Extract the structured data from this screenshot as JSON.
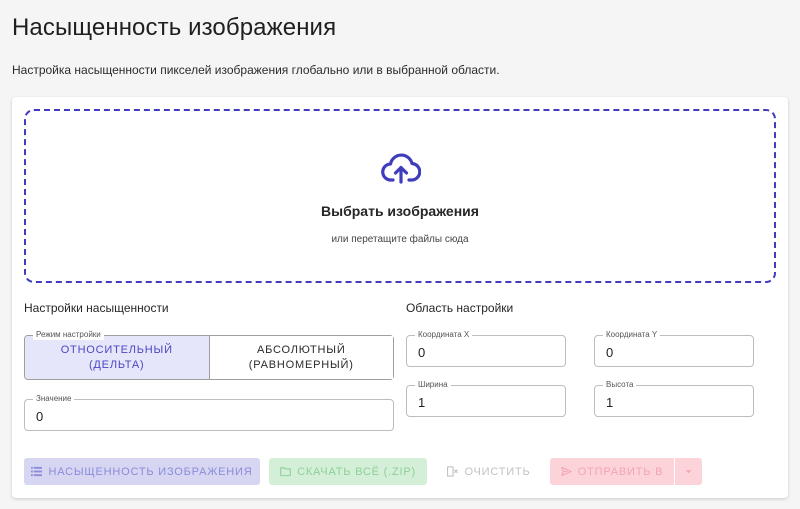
{
  "header": {
    "title": "Насыщенность изображения",
    "description": "Настройка насыщенности пикселей изображения глобально или в выбранной области."
  },
  "dropzone": {
    "title": "Выбрать изображения",
    "subtitle": "или перетащите файлы сюда",
    "icon": "cloud-upload-icon"
  },
  "saturation_settings": {
    "title": "Настройки насыщенности",
    "mode_label": "Режим настройки",
    "mode_options": [
      {
        "label": "Относительный (дельта)",
        "selected": true
      },
      {
        "label": "Абсолютный (равномерный)",
        "selected": false
      }
    ],
    "value_label": "Значение",
    "value": "0"
  },
  "area_settings": {
    "title": "Область настройки",
    "x_label": "Координата X",
    "x_value": "0",
    "y_label": "Координата Y",
    "y_value": "0",
    "width_label": "Ширина",
    "width_value": "1",
    "height_label": "Высота",
    "height_value": "1"
  },
  "actions": {
    "saturate_label": "Насыщенность изображения",
    "download_label": "Скачать всё (.zip)",
    "clear_label": "Очистить",
    "send_label": "Отправить в"
  },
  "colors": {
    "accent": "#3f3dbb",
    "toggle_active_bg": "#e6e6fb",
    "saturate_btn_bg": "#d6d6f3",
    "download_btn_bg": "#d4efd8",
    "send_btn_bg": "#fbd3d9"
  }
}
